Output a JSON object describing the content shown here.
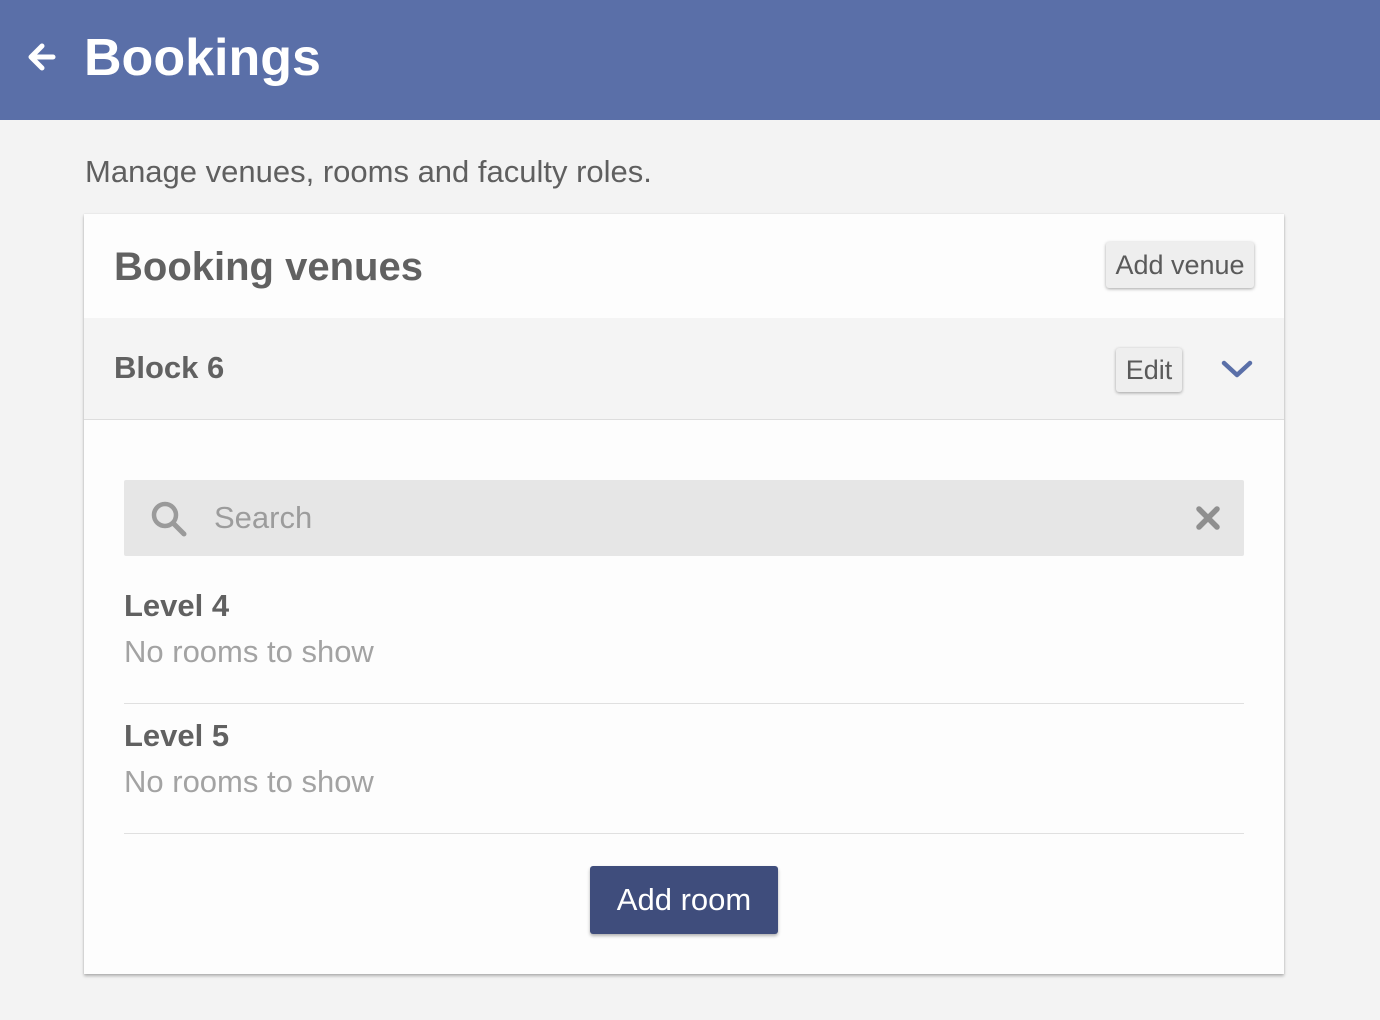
{
  "appbar": {
    "title": "Bookings",
    "back_icon": "arrow-left-icon",
    "background": "#5a6fa8"
  },
  "subtitle": "Manage venues, rooms and faculty roles.",
  "card": {
    "title": "Booking venues",
    "add_venue_label": "Add venue",
    "venue": {
      "name": "Block 6",
      "edit_label": "Edit",
      "expand_icon": "chevron-down-icon",
      "expanded": true,
      "search": {
        "placeholder": "Search",
        "value": "",
        "search_icon": "search-icon",
        "clear_icon": "close-icon"
      },
      "levels": [
        {
          "name": "Level 4",
          "status": "No rooms to show"
        },
        {
          "name": "Level 5",
          "status": "No rooms to show"
        }
      ],
      "add_room_label": "Add room"
    }
  },
  "colors": {
    "accent": "#5a6fa8",
    "primary_button": "#3f4d7c",
    "page_background": "#f3f3f3"
  }
}
